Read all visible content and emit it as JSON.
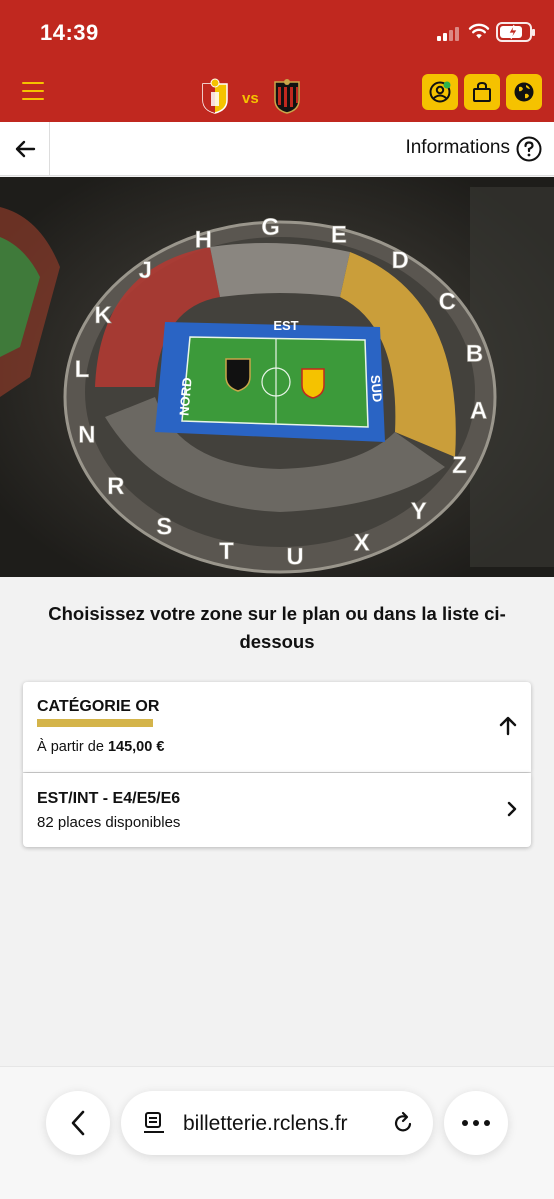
{
  "status_bar": {
    "time": "14:39"
  },
  "header": {
    "home_team_crest": "rc-lens-crest",
    "vs_label": "vs",
    "away_team_crest": "ogc-nice-crest",
    "accent_color": "#f5c200",
    "bar_color": "#c0281f",
    "actions": [
      "account-icon",
      "basket-icon",
      "language-globe-icon"
    ]
  },
  "navbar": {
    "back_icon": "arrow-left-icon",
    "info_label": "Informations",
    "help_icon": "question-circle-icon"
  },
  "stadium_map": {
    "stands": {
      "east": "EST",
      "north": "NORD",
      "south": "SUD"
    },
    "block_letters": [
      "L",
      "K",
      "J",
      "H",
      "G",
      "E",
      "D",
      "C",
      "B",
      "A",
      "Z",
      "Y",
      "X",
      "U",
      "T",
      "S",
      "R",
      "N"
    ]
  },
  "main": {
    "headline": "Choisissez votre zone sur le plan ou dans la liste ci-dessous",
    "category": {
      "title": "CATÉGORIE OR",
      "bar_color": "#d4b44a",
      "price_prefix": "À partir de",
      "price": "145,00 €"
    },
    "zones": [
      {
        "title": "EST/INT - E4/E5/E6",
        "availability": "82 places disponibles"
      }
    ]
  },
  "browser": {
    "url": "billetterie.rclens.fr"
  }
}
